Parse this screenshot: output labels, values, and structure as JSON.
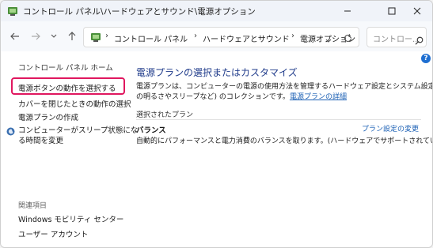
{
  "window": {
    "title": "コントロール パネル\\ハードウェアとサウンド\\電源オプション"
  },
  "address_bar": {
    "crumbs": [
      "コントロール パネル",
      "ハードウェアとサウンド",
      "電源オプション"
    ],
    "separator": "›"
  },
  "search": {
    "placeholder": "コントロー..."
  },
  "sidebar": {
    "home": "コントロール パネル ホーム",
    "items": [
      "電源ボタンの動作を選択する",
      "カバーを閉じたときの動作の選択",
      "電源プランの作成"
    ],
    "sleep_line1": "コンピューターがスリープ状態にな",
    "sleep_line2": "る時間を変更",
    "related_heading": "関連項目",
    "related": [
      "Windows モビリティ センター",
      "ユーザー アカウント"
    ]
  },
  "main": {
    "heading": "電源プランの選択またはカスタマイズ",
    "description_line1": "電源プランは、コンピューターの電源の使用方法を管理するハードウェア設定とシステム設定 (ディスプレイ",
    "description_line2_prefix": "の明るさやスリープなど) のコレクションです。",
    "description_link": "電源プランの詳細",
    "selected_plan_label": "選択されたプラン",
    "plan_name": "バランス",
    "plan_settings_link": "プラン設定の変更",
    "plan_description": "自動的にパフォーマンスと電力消費のバランスを取ります。(ハードウェアでサポートされている場合)"
  },
  "colors": {
    "highlight_border": "#e0175f",
    "link": "#1a5fb4",
    "heading": "#1e3a8a"
  },
  "icons": [
    "control-panel-icon",
    "minimize-icon",
    "maximize-icon",
    "close-icon",
    "back-arrow-icon",
    "forward-arrow-icon",
    "chevron-down-icon",
    "up-arrow-icon",
    "refresh-icon",
    "search-icon",
    "help-icon",
    "sleep-icon"
  ]
}
